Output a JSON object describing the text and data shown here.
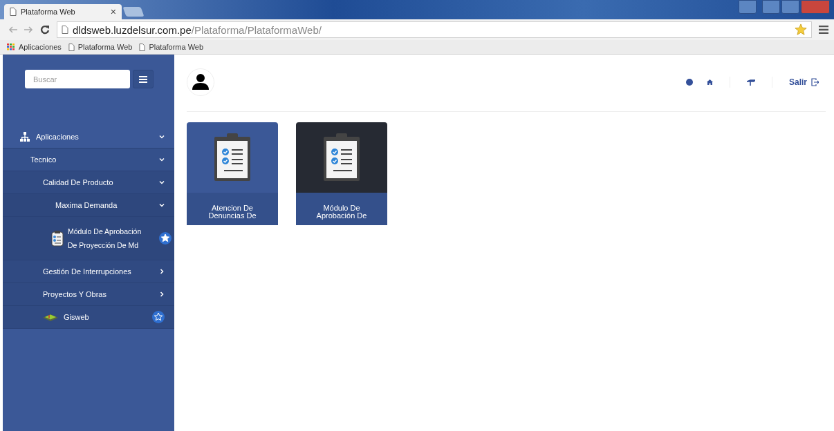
{
  "browser": {
    "tab": {
      "title": "Plataforma Web",
      "close": "×"
    },
    "url": {
      "host": "dldsweb.luzdelsur.com.pe",
      "path": "/Plataforma/PlataformaWeb/"
    },
    "bookmarks": [
      "Aplicaciones",
      "Plataforma Web",
      "Plataforma Web"
    ]
  },
  "sidebar": {
    "search": {
      "placeholder": "Buscar"
    },
    "menu": [
      {
        "label": "Aplicaciones",
        "kind": "root",
        "expanded": true,
        "children": [
          {
            "label": "Tecnico",
            "kind": "group",
            "expanded": true,
            "children": [
              {
                "label": "Calidad De Producto",
                "kind": "group",
                "expanded": true,
                "children": [
                  {
                    "label": "Maxima Demanda",
                    "kind": "group",
                    "expanded": true,
                    "children": [
                      {
                        "label": "Módulo De Aprobación De Proyección De Md",
                        "kind": "app",
                        "favorite": true
                      }
                    ]
                  }
                ]
              },
              {
                "label": "Gestión De Interrupciones",
                "kind": "group",
                "expanded": false
              },
              {
                "label": "Proyectos Y Obras",
                "kind": "group",
                "expanded": false
              },
              {
                "label": "Gisweb",
                "kind": "map",
                "favorite": false
              }
            ]
          }
        ]
      }
    ]
  },
  "header": {
    "logout": "Salir"
  },
  "tiles": [
    {
      "lines": [
        "Atencion De",
        "Denuncias De"
      ],
      "highlighted": false
    },
    {
      "lines": [
        "Módulo De",
        "Aprobación De"
      ],
      "highlighted": true
    }
  ]
}
